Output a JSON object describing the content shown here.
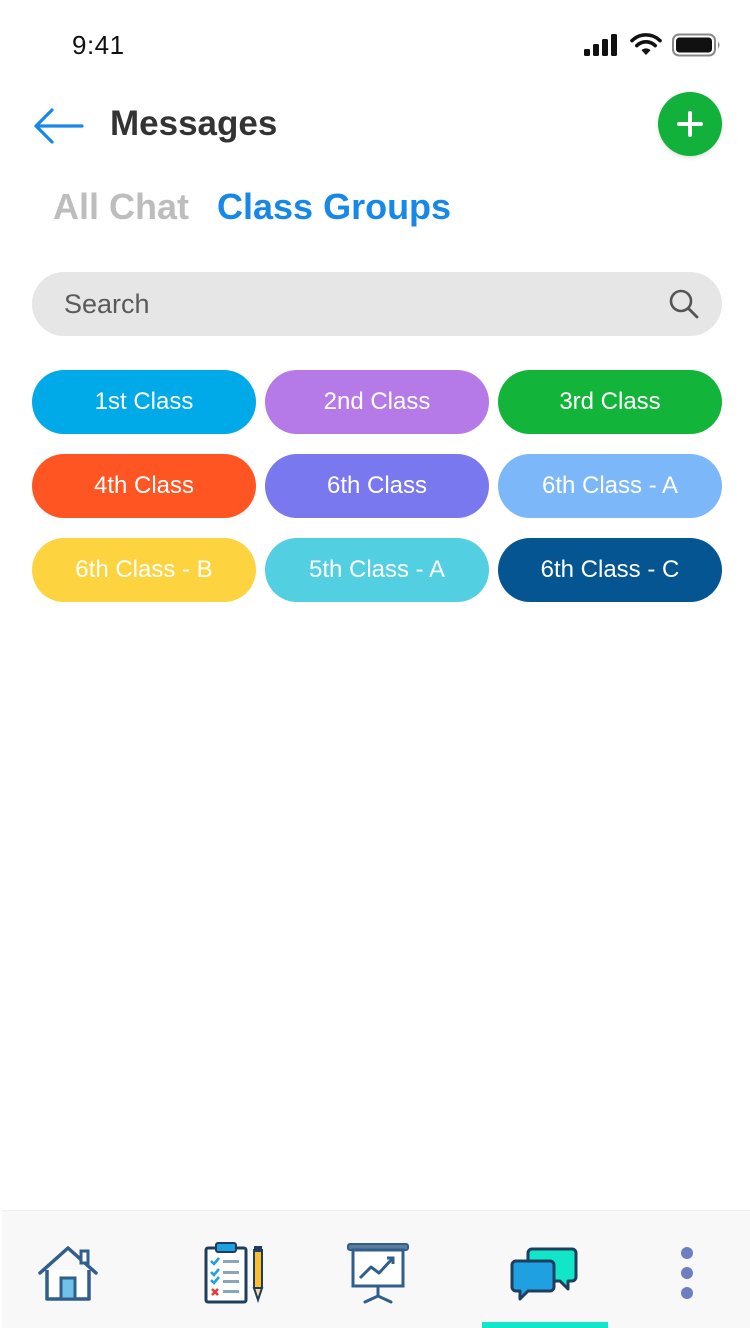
{
  "status_bar": {
    "time": "9:41",
    "icons": [
      "cellular-signal-icon",
      "wifi-icon",
      "battery-icon"
    ]
  },
  "header": {
    "title": "Messages",
    "back_icon": "arrow-left-icon",
    "add_icon": "plus-icon",
    "colors": {
      "back": "#1787E8",
      "add_button": "#12B13C"
    }
  },
  "tabs": [
    {
      "label": "All Chat",
      "active": false
    },
    {
      "label": "Class Groups",
      "active": true
    }
  ],
  "search": {
    "placeholder": "Search",
    "value": "",
    "icon": "search-icon"
  },
  "class_groups": [
    {
      "label": "1st Class",
      "color": "#00A9E8"
    },
    {
      "label": "2nd Class",
      "color": "#B57AE8"
    },
    {
      "label": "3rd Class",
      "color": "#12B43A"
    },
    {
      "label": "4th Class",
      "color": "#FF5522"
    },
    {
      "label": "6th Class",
      "color": "#7A78EE"
    },
    {
      "label": "6th Class - A",
      "color": "#7CB8F9"
    },
    {
      "label": "6th Class - B",
      "color": "#FDD340"
    },
    {
      "label": "5th Class - A",
      "color": "#53CFE2"
    },
    {
      "label": "6th Class - C",
      "color": "#055592"
    }
  ],
  "bottom_nav": {
    "items": [
      {
        "icon": "home-icon",
        "active": false
      },
      {
        "icon": "clipboard-checklist-icon",
        "active": false
      },
      {
        "icon": "presentation-chart-icon",
        "active": false
      },
      {
        "icon": "chat-bubbles-icon",
        "active": true
      },
      {
        "icon": "more-vertical-icon",
        "active": false
      }
    ],
    "indicator_color": "#12E6C9"
  }
}
